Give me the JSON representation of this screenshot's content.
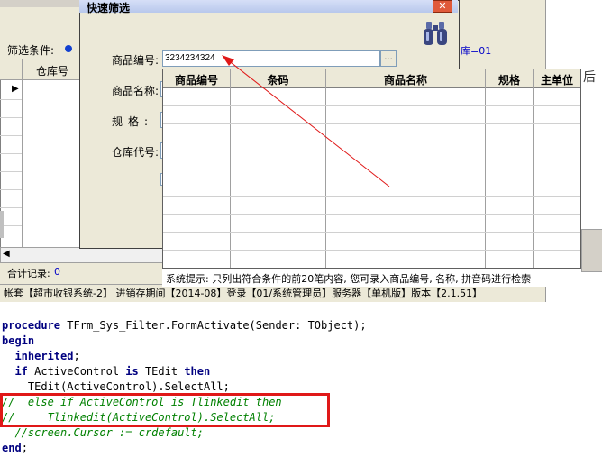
{
  "background_window": {
    "filter_label": "筛选条件:",
    "warehouse_filter": "库=01",
    "right_text": "后",
    "grid_column": "仓库号",
    "total_label": "合计记录:",
    "total_value": "0",
    "status": "帐套【超市收银系统-2】 进销存期间【2014-08】登录【01/系统管理员】服务器【单机版】版本【2.1.51】"
  },
  "dialog": {
    "title": "快速筛选",
    "close_icon": "close-icon",
    "binoculars_icon": "binoculars-icon",
    "fields": {
      "product_code_label": "商品编号:",
      "product_code_value": "3234234324",
      "product_name_label": "商品名称:",
      "spec_label": "规格:",
      "warehouse_code_label": "仓库代号:"
    },
    "ellipsis_button": "...",
    "popup": {
      "columns": [
        "商品编号",
        "条码",
        "商品名称",
        "规格",
        "主单位"
      ],
      "hint": "系统提示: 只列出符合条件的前20笔内容, 您可录入商品编号, 名称, 拼音码进行检索"
    }
  },
  "code": {
    "lines": [
      "procedure TFrm_Sys_Filter.FormActivate(Sender: TObject);",
      "begin",
      "  inherited;",
      "  if ActiveControl is TEdit then",
      "    TEdit(ActiveControl).SelectAll;",
      "//  else if ActiveControl is Tlinkedit then",
      "//     Tlinkedit(ActiveControl).SelectAll;",
      "  //screen.Cursor := crdefault;",
      "end;"
    ]
  },
  "colors": {
    "annotation_arrow": "#e01818",
    "highlight_box": "#e01818",
    "keyword": "#000080",
    "comment": "#008000"
  }
}
